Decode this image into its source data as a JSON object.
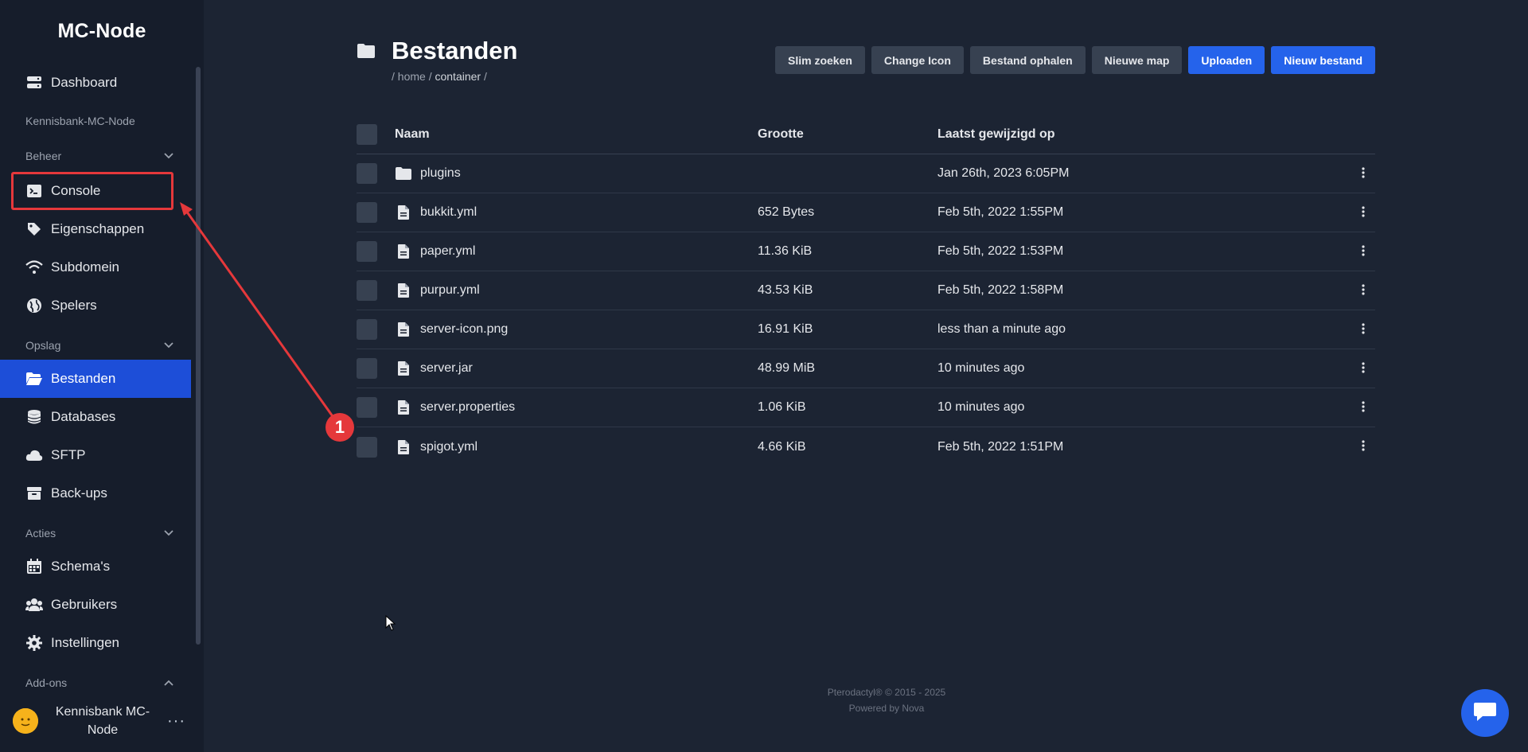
{
  "app": {
    "brand": "MC-Node"
  },
  "sidebar": {
    "dashboard": "Dashboard",
    "server_name": "Kennisbank-MC-Node",
    "sections": {
      "beheer": "Beheer",
      "opslag": "Opslag",
      "acties": "Acties",
      "addons": "Add-ons"
    },
    "items": {
      "console": "Console",
      "eigenschappen": "Eigenschappen",
      "subdomein": "Subdomein",
      "spelers": "Spelers",
      "bestanden": "Bestanden",
      "databases": "Databases",
      "sftp": "SFTP",
      "backups": "Back-ups",
      "schemas": "Schema's",
      "gebruikers": "Gebruikers",
      "instellingen": "Instellingen"
    },
    "user": {
      "name": "Kennisbank MC-Node",
      "menu": "···"
    }
  },
  "header": {
    "title": "Bestanden",
    "breadcrumb": {
      "sep1": "/",
      "home": "home",
      "sep2": "/",
      "container": "container",
      "sep3": "/"
    }
  },
  "toolbar": {
    "slim_zoeken": "Slim zoeken",
    "change_icon": "Change Icon",
    "bestand_ophalen": "Bestand ophalen",
    "nieuwe_map": "Nieuwe map",
    "uploaden": "Uploaden",
    "nieuw_bestand": "Nieuw bestand"
  },
  "table": {
    "columns": {
      "name": "Naam",
      "size": "Grootte",
      "modified": "Laatst gewijzigd op"
    },
    "rows": [
      {
        "name": "plugins",
        "size": "",
        "modified": "Jan 26th, 2023 6:05PM",
        "type": "folder"
      },
      {
        "name": "bukkit.yml",
        "size": "652 Bytes",
        "modified": "Feb 5th, 2022 1:55PM",
        "type": "file"
      },
      {
        "name": "paper.yml",
        "size": "11.36 KiB",
        "modified": "Feb 5th, 2022 1:53PM",
        "type": "file"
      },
      {
        "name": "purpur.yml",
        "size": "43.53 KiB",
        "modified": "Feb 5th, 2022 1:58PM",
        "type": "file"
      },
      {
        "name": "server-icon.png",
        "size": "16.91 KiB",
        "modified": "less than a minute ago",
        "type": "file"
      },
      {
        "name": "server.jar",
        "size": "48.99 MiB",
        "modified": "10 minutes ago",
        "type": "file"
      },
      {
        "name": "server.properties",
        "size": "1.06 KiB",
        "modified": "10 minutes ago",
        "type": "file"
      },
      {
        "name": "spigot.yml",
        "size": "4.66 KiB",
        "modified": "Feb 5th, 2022 1:51PM",
        "type": "file"
      }
    ]
  },
  "footer": {
    "line1": "Pterodactyl® © 2015 - 2025",
    "line2": "Powered by Nova"
  },
  "annotation": {
    "badge": "1"
  },
  "colors": {
    "accent": "#2563eb",
    "active_nav": "#1d4ed8",
    "annotation": "#e5383b",
    "background": "#1c2433",
    "sidebar": "#161d2b"
  }
}
